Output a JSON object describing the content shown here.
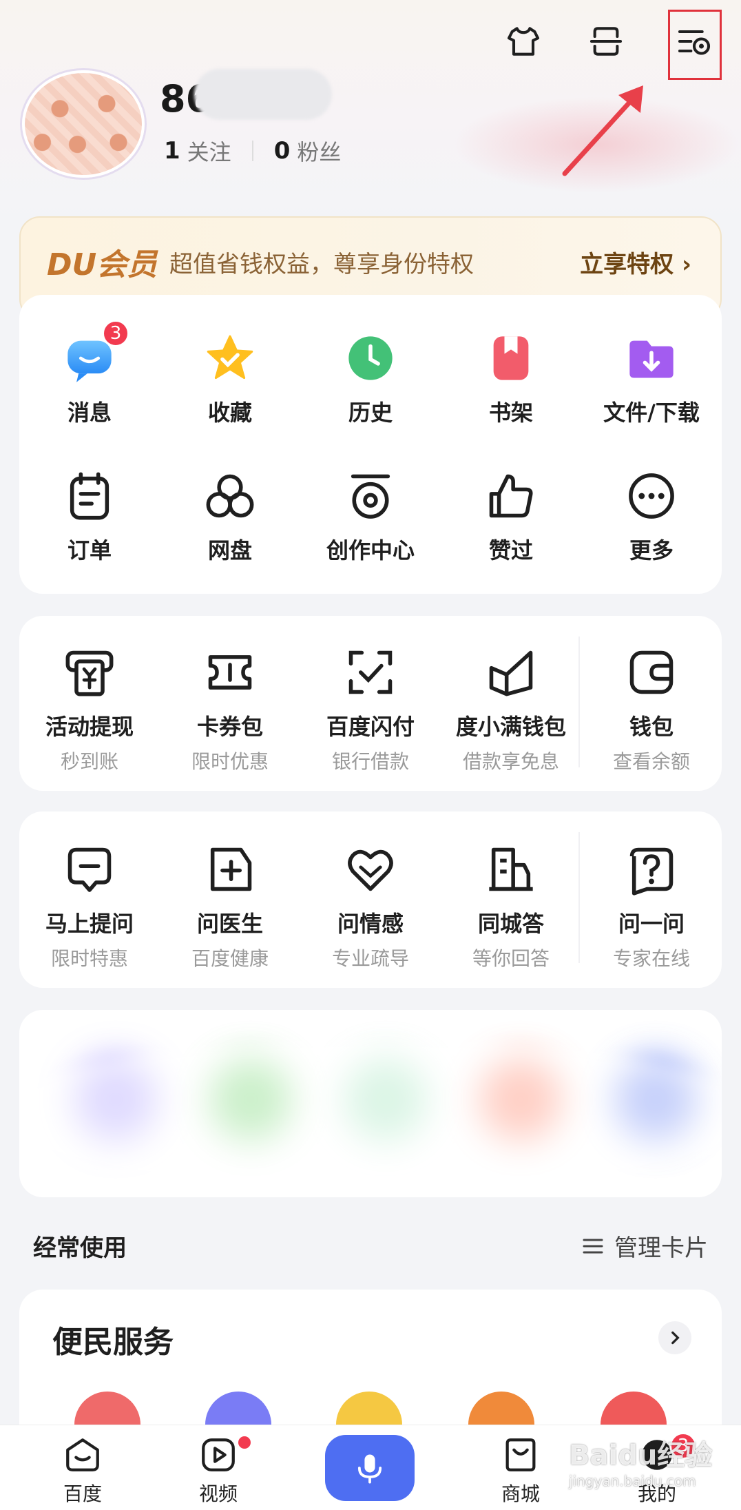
{
  "header": {
    "username_visible": "86",
    "following_count": "1",
    "following_label": "关注",
    "followers_count": "0",
    "followers_label": "粉丝",
    "icons": [
      "tshirt-icon",
      "scan-icon",
      "settings-icon"
    ]
  },
  "vip": {
    "logo": "DU会员",
    "description": "超值省钱权益，尊享身份特权",
    "cta": "立享特权 ›"
  },
  "quick_row1": [
    {
      "label": "消息",
      "badge": "3"
    },
    {
      "label": "收藏"
    },
    {
      "label": "历史"
    },
    {
      "label": "书架"
    },
    {
      "label": "文件/下载"
    }
  ],
  "quick_row2": [
    {
      "label": "订单"
    },
    {
      "label": "网盘"
    },
    {
      "label": "创作中心"
    },
    {
      "label": "赞过"
    },
    {
      "label": "更多"
    }
  ],
  "finance": [
    {
      "label": "活动提现",
      "sub": "秒到账"
    },
    {
      "label": "卡券包",
      "sub": "限时优惠"
    },
    {
      "label": "百度闪付",
      "sub": "银行借款"
    },
    {
      "label": "度小满钱包",
      "sub": "借款享免息"
    },
    {
      "label": "钱包",
      "sub": "查看余额"
    }
  ],
  "ask": [
    {
      "label": "马上提问",
      "sub": "限时特惠"
    },
    {
      "label": "问医生",
      "sub": "百度健康"
    },
    {
      "label": "问情感",
      "sub": "专业疏导"
    },
    {
      "label": "同城答",
      "sub": "等你回答"
    },
    {
      "label": "问一问",
      "sub": "专家在线"
    }
  ],
  "frequent": {
    "title": "经常使用",
    "manage": "管理卡片"
  },
  "services": {
    "title": "便民服务"
  },
  "tabbar": [
    {
      "label": "百度"
    },
    {
      "label": "视频"
    },
    {
      "label": "商城"
    },
    {
      "label": "我的",
      "badge": "3"
    }
  ],
  "watermark": {
    "main": "Baidu经验",
    "sub": "jingyan.baidu.com"
  },
  "colors": {
    "accent": "#4e6ef2",
    "badge": "#f23a4f",
    "highlight": "#e0323c",
    "vip_text": "#c3752d"
  }
}
